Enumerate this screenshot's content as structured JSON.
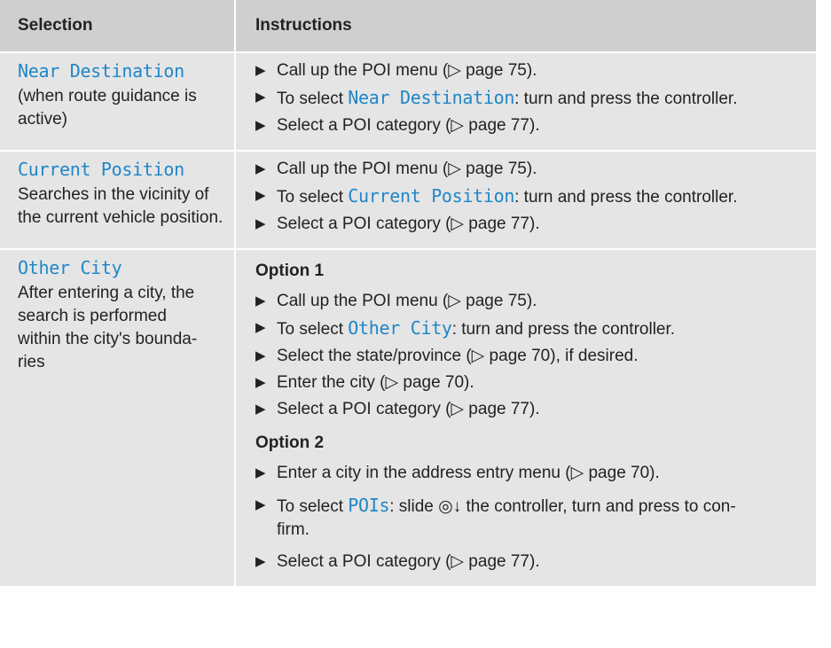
{
  "header": {
    "selection": "Selection",
    "instructions": "Instructions"
  },
  "rows": [
    {
      "code": "Near Destination",
      "desc": "(when route guidance is active)",
      "steps": [
        {
          "pre": "Call up the POI menu (▷ page 75).",
          "code": "",
          "post": ""
        },
        {
          "pre": "To select ",
          "code": "Near Destination",
          "post": ": turn and press the controller."
        },
        {
          "pre": "Select a POI category (▷ page 77).",
          "code": "",
          "post": ""
        }
      ]
    },
    {
      "code": "Current Position",
      "desc": "Searches in the vicinity of the current vehicle position.",
      "steps": [
        {
          "pre": "Call up the POI menu (▷ page 75).",
          "code": "",
          "post": ""
        },
        {
          "pre": "To select ",
          "code": "Current Position",
          "post": ": turn and press the controller."
        },
        {
          "pre": "Select a POI category (▷ page 77).",
          "code": "",
          "post": ""
        }
      ]
    },
    {
      "code": "Other City",
      "desc_lines": [
        "After entering a city, the",
        "search is performed",
        "within the city's bounda-",
        "ries"
      ],
      "option1": {
        "label": "Option 1",
        "steps": [
          {
            "pre": "Call up the POI menu (▷ page 75).",
            "code": "",
            "post": ""
          },
          {
            "pre": "To select ",
            "code": "Other City",
            "post": ": turn and press the controller."
          },
          {
            "pre": "Select the state/province (▷ page 70), if desired.",
            "code": "",
            "post": ""
          },
          {
            "pre": "Enter the city (▷ page 70).",
            "code": "",
            "post": ""
          },
          {
            "pre": "Select a POI category (▷ page 77).",
            "code": "",
            "post": ""
          }
        ]
      },
      "option2": {
        "label": "Option 2",
        "steps": [
          {
            "pre": "Enter a city in the address entry menu (▷ page 70).",
            "code": "",
            "post": ""
          },
          {
            "pre": "To select ",
            "code": "POIs",
            "post": ": slide ◎↓ the controller, turn and press to con-",
            "post2": "firm."
          },
          {
            "pre": "Select a POI category (▷ page 77).",
            "code": "",
            "post": ""
          }
        ]
      }
    }
  ],
  "arrow": "▶"
}
